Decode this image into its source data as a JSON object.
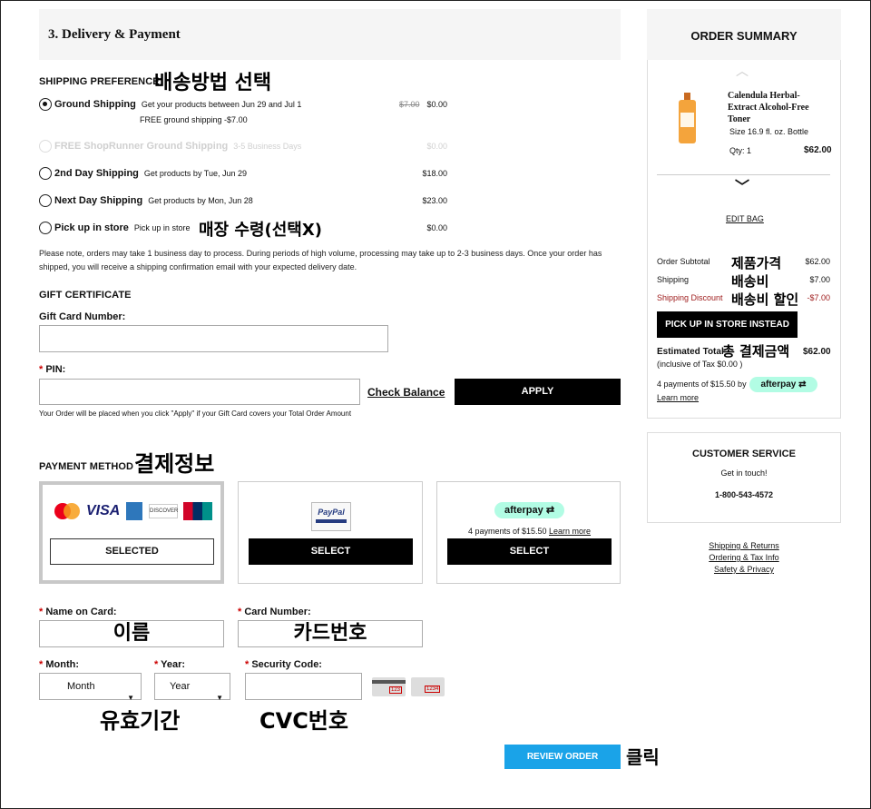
{
  "section": {
    "title": "3. Delivery & Payment"
  },
  "shipping": {
    "heading": "SHIPPING PREFERENCE",
    "annotation": "배송방법 선택",
    "options": [
      {
        "name": "Ground Shipping",
        "desc": "Get your products between Jun 29 and Jul 1",
        "sub": "FREE ground shipping -$7.00",
        "old_price": "$7.00",
        "price": "$0.00"
      },
      {
        "name": "FREE ShopRunner Ground Shipping",
        "desc": "3-5 Business Days",
        "price": "$0.00"
      },
      {
        "name": "2nd Day Shipping",
        "desc": "Get products by Tue, Jun 29",
        "price": "$18.00"
      },
      {
        "name": "Next Day Shipping",
        "desc": "Get products by Mon, Jun 28",
        "price": "$23.00"
      },
      {
        "name": "Pick up in store",
        "desc": "Pick up in store",
        "price": "$0.00"
      }
    ],
    "pickup_annotation": "매장 수령(선택X)",
    "note": "Please note, orders may take 1 business day to process. During periods of high volume, processing may take up to 2-3 business days. Once your order has shipped, you will receive a shipping confirmation email with your expected delivery date."
  },
  "gift": {
    "heading": "GIFT CERTIFICATE",
    "card_label": "Gift Card Number:",
    "pin_label": "PIN:",
    "req_mark": "*",
    "check_balance": "Check Balance",
    "apply": "APPLY",
    "note": "Your Order will be placed when you click \"Apply\" if your Gift Card covers your Total Order Amount"
  },
  "payment": {
    "heading": "PAYMENT METHOD",
    "annotation": "결제정보",
    "cards": {
      "mastercard": "MasterCard",
      "visa": "VISA",
      "amex": "AMEX",
      "discover": "DISCOVER",
      "unionpay": "UnionPay"
    },
    "selected": "SELECTED",
    "select": "SELECT",
    "paypal": "PayPal",
    "afterpay": "afterpay",
    "afterpay_text": "4 payments of $15.50",
    "learn_more": "Learn more",
    "name_label": "Name on Card:",
    "name_annotation": "이름",
    "number_label": "Card Number:",
    "number_annotation": "카드번호",
    "month_label": "Month:",
    "year_label": "Year:",
    "month_value": "Month",
    "year_value": "Year",
    "cvc_label": "Security Code:",
    "expiry_annotation": "유효기간",
    "cvc_annotation": "CVC번호",
    "cvc_card1": "123",
    "cvc_card2": "1234"
  },
  "review": {
    "label": "REVIEW ORDER",
    "annotation": "클릭"
  },
  "summary": {
    "heading": "ORDER SUMMARY",
    "product_name": "Calendula Herbal-Extract Alcohol-Free Toner",
    "size": "Size 16.9 fl. oz. Bottle",
    "qty": "Qty: 1",
    "price": "$62.00",
    "edit_bag": "EDIT BAG",
    "subtotal_label": "Order Subtotal",
    "subtotal_annotation": "제품가격",
    "subtotal": "$62.00",
    "shipping_label": "Shipping",
    "shipping_annotation": "배송비",
    "shipping": "$7.00",
    "discount_label": "Shipping Discount",
    "discount_annotation": "배송비 할인",
    "discount": "-$7.00",
    "pickup_btn": "PICK UP IN STORE INSTEAD",
    "total_label": "Estimated Total",
    "total_annotation": "총 결제금액",
    "total": "$62.00",
    "tax": "(inclusive of Tax $0.00 )",
    "afterpay_text": "4 payments of $15.50 by",
    "afterpay": "afterpay",
    "learn_more": "Learn more"
  },
  "service": {
    "heading": "CUSTOMER SERVICE",
    "text": "Get in touch!",
    "phone": "1-800-543-4572",
    "links": [
      "Shipping & Returns",
      "Ordering & Tax Info",
      "Safety & Privacy"
    ]
  },
  "colors": {
    "accent": "#1aa3e8",
    "afterpay": "#b2fce4",
    "discount": "#a02020"
  }
}
